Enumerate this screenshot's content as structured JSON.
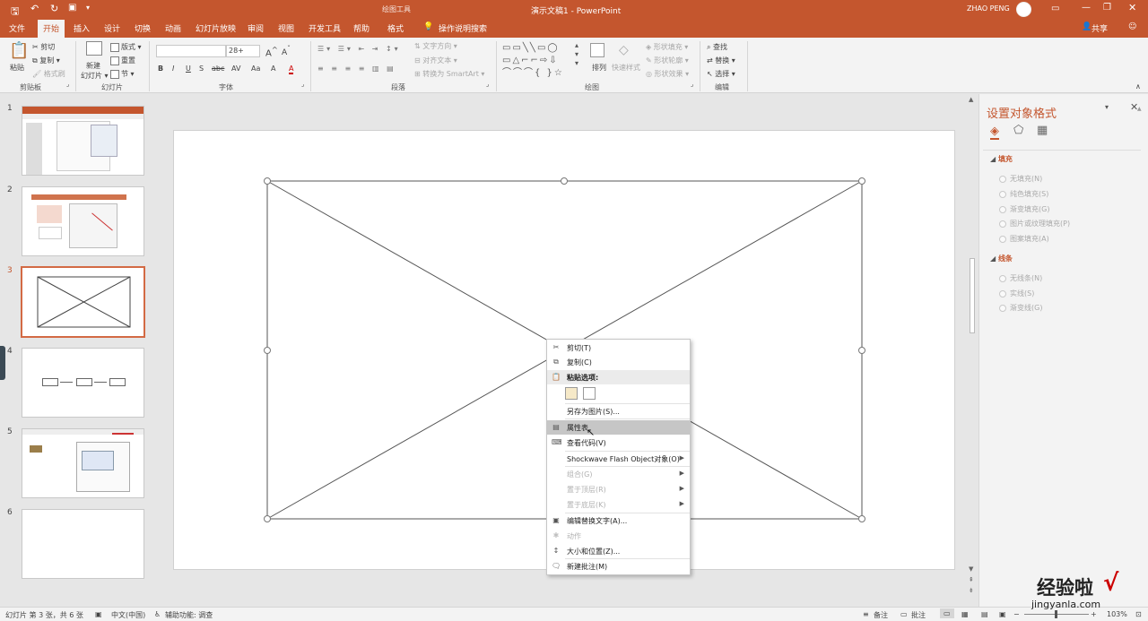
{
  "titlebar": {
    "drawing_tools": "绘图工具",
    "title": "演示文稿1  -  PowerPoint",
    "user": "ZHAO PENG",
    "window_controls": [
      "minimize-icon",
      "restore-icon",
      "close-icon"
    ]
  },
  "tabs": [
    "文件",
    "开始",
    "插入",
    "设计",
    "切换",
    "动画",
    "幻灯片放映",
    "审阅",
    "视图",
    "开发工具",
    "帮助",
    "格式"
  ],
  "active_tab": "开始",
  "tell_me": "操作说明搜索",
  "share": "共享",
  "ribbon": {
    "clipboard": {
      "paste": "粘贴",
      "cut": "剪切",
      "copy": "复制",
      "format_painter": "格式刷",
      "group": "剪贴板"
    },
    "slides": {
      "new_slide_line1": "新建",
      "new_slide_line2": "幻灯片",
      "layout": "版式",
      "reset": "重置",
      "section": "节",
      "group": "幻灯片"
    },
    "font": {
      "font_name": "",
      "font_size": "28+",
      "bold": "B",
      "italic": "I",
      "underline": "U",
      "shadow": "S",
      "strike": "abc",
      "spacing": "AV",
      "case": "Aa",
      "clear": "A",
      "color": "A",
      "group": "字体"
    },
    "paragraph": {
      "text_direction": "文字方向",
      "align_text": "对齐文本",
      "smartart": "转换为 SmartArt",
      "group": "段落"
    },
    "drawing": {
      "arrange": "排列",
      "quick_styles": "快速样式",
      "shape_fill": "形状填充",
      "shape_outline": "形状轮廓",
      "shape_effects": "形状效果",
      "group": "绘图"
    },
    "editing": {
      "find": "查找",
      "replace": "替换",
      "select": "选择",
      "group": "编辑"
    }
  },
  "slides": [
    {
      "number": "1"
    },
    {
      "number": "2"
    },
    {
      "number": "3"
    },
    {
      "number": "4",
      "labels": [
        "",
        "",
        "",
        ""
      ]
    },
    {
      "number": "5"
    },
    {
      "number": "6"
    }
  ],
  "selected_slide": "3",
  "context_menu": {
    "items": [
      {
        "label": "剪切(T)",
        "icon": "scissors-icon",
        "disabled": false
      },
      {
        "label": "复制(C)",
        "icon": "copy-icon",
        "disabled": false
      },
      {
        "label": "粘贴选项:",
        "icon": "paste-icon",
        "disabled": false
      },
      {
        "label": "另存为图片(S)...",
        "icon": "",
        "disabled": false
      },
      {
        "label": "属性表",
        "icon": "properties-icon",
        "disabled": false
      },
      {
        "label": "查看代码(V)",
        "icon": "code-icon",
        "disabled": false
      },
      {
        "label": "Shockwave Flash Object对象(O)",
        "icon": "",
        "disabled": false
      },
      {
        "label": "组合(G)",
        "icon": "",
        "disabled": true
      },
      {
        "label": "置于顶层(R)",
        "icon": "",
        "disabled": true
      },
      {
        "label": "置于底层(K)",
        "icon": "",
        "disabled": true
      },
      {
        "label": "编辑替换文字(A)...",
        "icon": "alt-text-icon",
        "disabled": false
      },
      {
        "label": "动作",
        "icon": "action-icon",
        "disabled": true
      },
      {
        "label": "大小和位置(Z)...",
        "icon": "size-icon",
        "disabled": false
      },
      {
        "label": "新建批注(M)",
        "icon": "comment-icon",
        "disabled": false
      }
    ]
  },
  "format_pane": {
    "title": "设置对象格式",
    "fill_section": "填充",
    "fill_options": [
      "无填充(N)",
      "纯色填充(S)",
      "渐变填充(G)",
      "图片或纹理填充(P)",
      "图案填充(A)"
    ],
    "line_section": "线条",
    "line_options": [
      "无线条(N)",
      "实线(S)",
      "渐变线(G)"
    ]
  },
  "statusbar": {
    "slide_info": "幻灯片 第 3 张，共 6 张",
    "language": "中文(中国)",
    "accessibility": "辅助功能: 调查",
    "notes": "备注",
    "comments": "批注",
    "zoom": "103%"
  },
  "watermark": {
    "line1": "经验啦",
    "check": "√",
    "line2": "jingyanla.com"
  },
  "colors": {
    "accent": "#c4562e",
    "ribbon_bg": "#f3f3f3",
    "menu_highlight": "#c6c6c6"
  }
}
